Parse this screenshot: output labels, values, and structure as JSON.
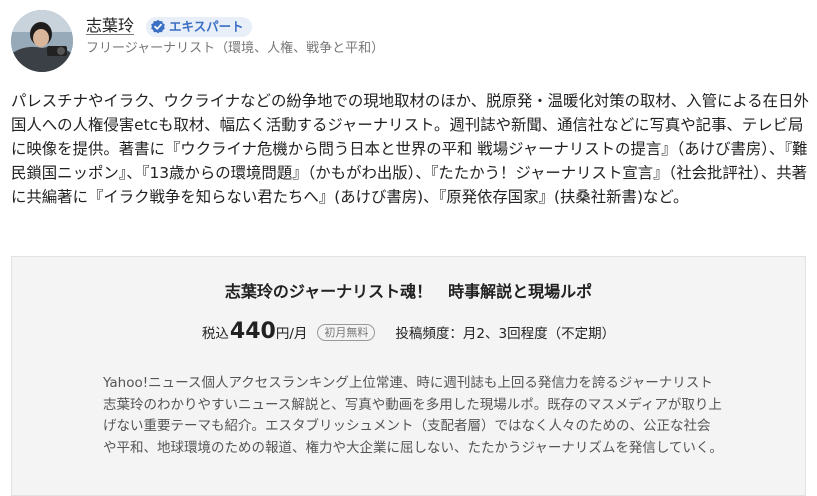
{
  "author": {
    "name": "志葉玲",
    "badge_label": "エキスパート",
    "subtitle": "フリージャーナリスト（環境、人権、戦争と平和）"
  },
  "bio": "パレスチナやイラク、ウクライナなどの紛争地での現地取材のほか、脱原発・温暖化対策の取材、入管による在日外国人への人権侵害etcも取材、幅広く活動するジャーナリスト。週刊誌や新聞、通信社などに写真や記事、テレビ局に映像を提供。著書に『ウクライナ危機から問う日本と世界の平和 戦場ジャーナリストの提言』（あけび書房）、『難民鎖国ニッポン』、『13歳からの環境問題』（かもがわ出版）、『たたかう！ジャーナリスト宣言』（社会批評社）、共著に共編著に『イラク戦争を知らない君たちへ』(あけび書房)、『原発依存国家』(扶桑社新書)など。",
  "subscription": {
    "title": "志葉玲のジャーナリスト魂！　時事解説と現場ルポ",
    "price_tax_label": "税込",
    "price_amount": "440",
    "price_unit": "円/月",
    "trial_badge": "初月無料",
    "frequency": "投稿頻度：月2、3回程度（不定期）",
    "description": "Yahoo!ニュース個人アクセスランキング上位常連、時に週刊誌も上回る発信力を誇るジャーナリスト志葉玲のわかりやすいニュース解説と、写真や動画を多用した現場ルポ。既存のマスメディアが取り上げない重要テーマも紹介。エスタブリッシュメント（支配者層）ではなく人々のための、公正な社会や平和、地球環境のための報道、権力や大企業に屈しない、たたかうジャーナリズムを発信していく。"
  },
  "colors": {
    "badge_bg": "#e9eff8",
    "badge_text": "#3a6fc4",
    "box_bg": "#f4f4f4",
    "muted_text": "#777777"
  },
  "icons": {
    "avatar": "author-photo",
    "badge": "verified-check-icon"
  }
}
